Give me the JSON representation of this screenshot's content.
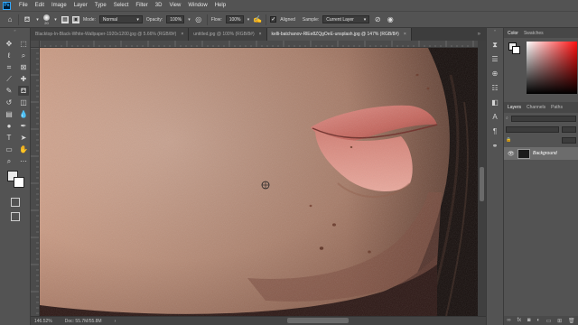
{
  "app": {
    "logo_text": "Ps"
  },
  "menu": [
    "File",
    "Edit",
    "Image",
    "Layer",
    "Type",
    "Select",
    "Filter",
    "3D",
    "View",
    "Window",
    "Help"
  ],
  "options": {
    "brush_size": "20",
    "mode_label": "Mode:",
    "mode_value": "Normal",
    "opacity_label": "Opacity:",
    "opacity_value": "100%",
    "flow_label": "Flow:",
    "flow_value": "100%",
    "aligned_label": "Aligned",
    "sample_label": "Sample:",
    "sample_value": "Current Layer"
  },
  "tabs": [
    {
      "title": "Blacktop-In-Black-White-Wallpaper-1920x1200.jpg @ 5.66% (RGB/8#)",
      "close": "×"
    },
    {
      "title": "untitled.jpg @ 100% (RGB/8#)",
      "close": "×"
    },
    {
      "title": "kelli-batchanov-RlEe8ZQgOeE-unsplash.jpg @ 147% (RGB/8#)",
      "close": "×"
    }
  ],
  "status": {
    "zoom": "146.52%",
    "doc": "Doc: 55.7M/55.8M"
  },
  "panels": {
    "color_tab": "Color",
    "swatches_tab": "Swatches",
    "layers_tab": "Layers",
    "channels_tab": "Channels",
    "paths_tab": "Paths"
  },
  "layers": [
    {
      "name": "Background",
      "visible": true
    }
  ],
  "icons": {
    "home": "home-icon",
    "brush_preset": "stamp-icon",
    "brush_settings": "brush-settings-icon",
    "pressure": "pressure-icon",
    "airbrush": "airbrush-icon",
    "sample_all": "sample-all-icon",
    "pressure_size": "pressure-size-icon"
  },
  "colors": {
    "foreground": "#e9e9e9",
    "background": "#ffffff",
    "accent": "#31a8ff"
  }
}
